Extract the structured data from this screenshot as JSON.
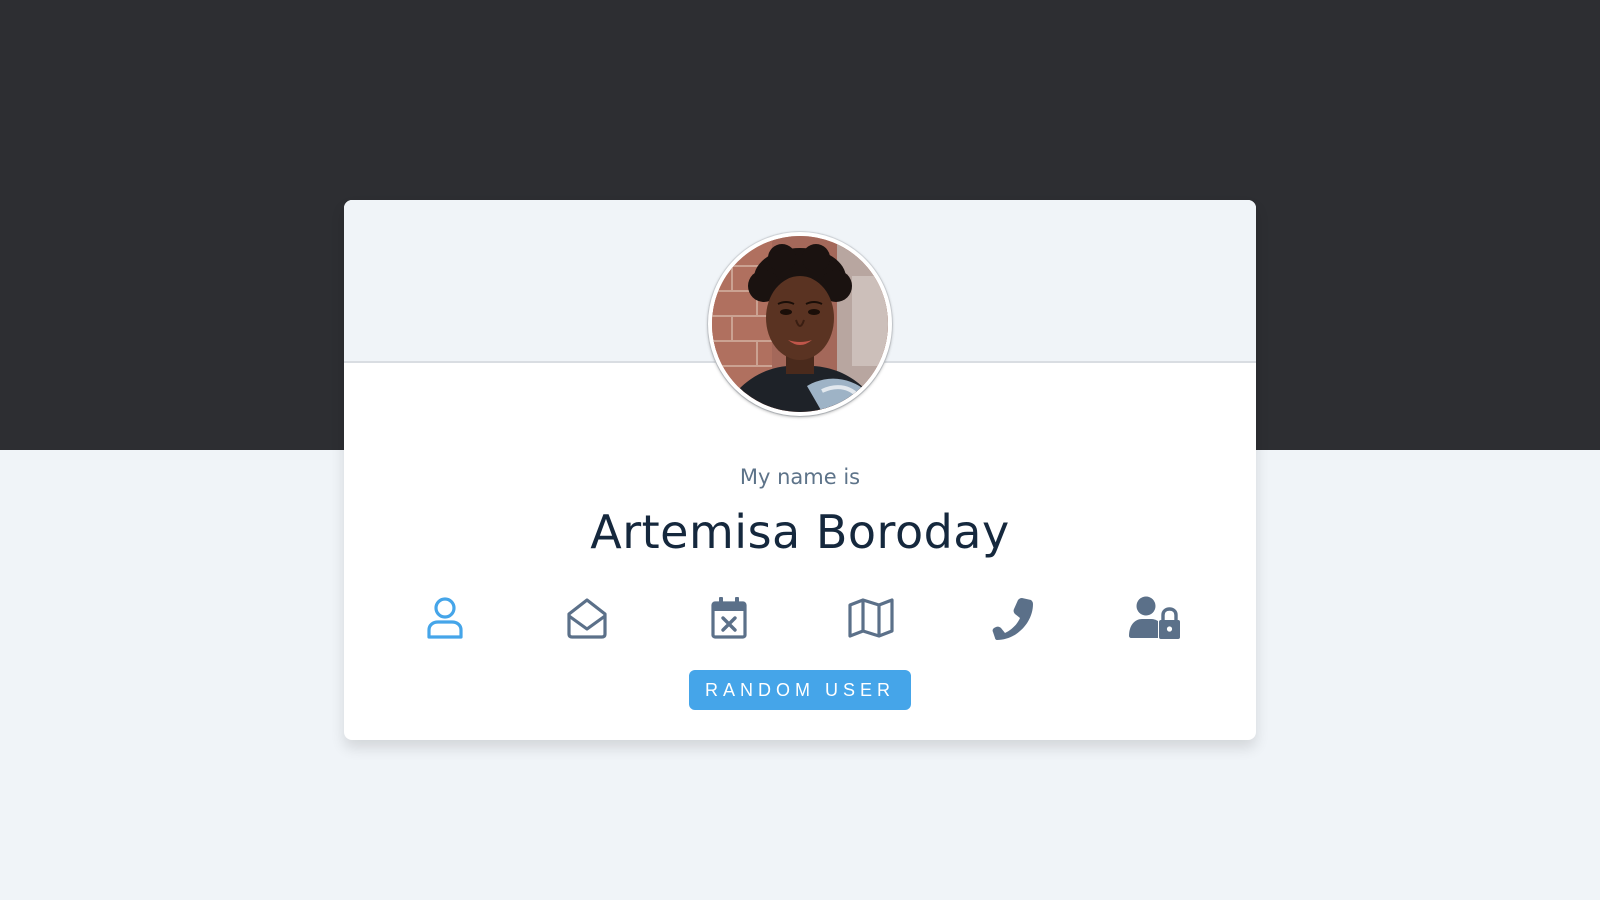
{
  "profile": {
    "label": "My name is",
    "value": "Artemisa Boroday"
  },
  "icons": [
    {
      "name": "user-icon",
      "active": true
    },
    {
      "name": "envelope-open-icon",
      "active": false
    },
    {
      "name": "calendar-times-icon",
      "active": false
    },
    {
      "name": "map-icon",
      "active": false
    },
    {
      "name": "phone-icon",
      "active": false
    },
    {
      "name": "user-lock-icon",
      "active": false
    }
  ],
  "actions": {
    "random_user_label": "RANDOM USER"
  },
  "colors": {
    "background_dark": "#2d2e32",
    "background_light": "#f0f4f8",
    "card": "#ffffff",
    "icon_default": "#5b7089",
    "icon_active": "#45a5e9",
    "button": "#45a5e9",
    "name_text": "#15283d",
    "label_text": "#5d7389"
  }
}
